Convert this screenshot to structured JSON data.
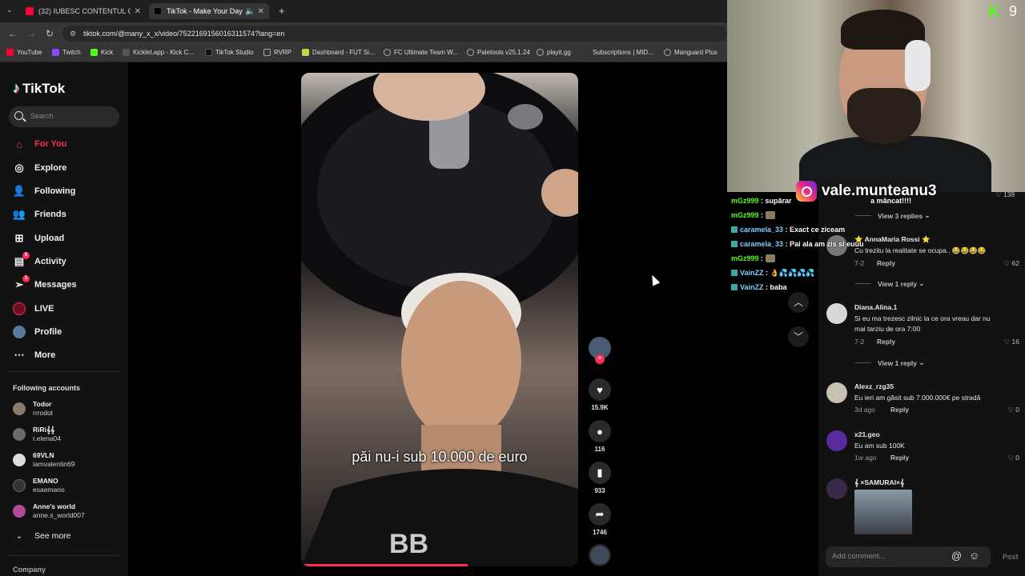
{
  "browser": {
    "tabs": [
      {
        "label": "(32) IUBESC CONTENTUL CRING",
        "active": false
      },
      {
        "label": "TikTok - Make Your Day",
        "active": true
      }
    ],
    "new_tab": "+",
    "url": "tiktok.com/@many_x_x/video/7522169156016311574?lang=en",
    "bookmarks": [
      "YouTube",
      "Twitch",
      "Kick",
      "Kicklet.app - Kick C...",
      "TikTok Studio",
      "RVRP",
      "Dashboard - FUT Si...",
      "FC Ultimate Team W...",
      "Paletools v25.1.24",
      "playit.gg",
      "Subscriptions | MID...",
      "Manguard Plus"
    ]
  },
  "sidebar": {
    "logo": "TikTok",
    "search_placeholder": "Search",
    "nav": [
      {
        "label": "For You",
        "icon": "home-icon",
        "active": true
      },
      {
        "label": "Explore",
        "icon": "compass-icon"
      },
      {
        "label": "Following",
        "icon": "following-icon"
      },
      {
        "label": "Friends",
        "icon": "friends-icon"
      },
      {
        "label": "Upload",
        "icon": "upload-icon"
      },
      {
        "label": "Activity",
        "icon": "activity-icon",
        "badge": "5"
      },
      {
        "label": "Messages",
        "icon": "messages-icon",
        "badge": "1"
      },
      {
        "label": "LIVE",
        "icon": "live-icon"
      },
      {
        "label": "Profile",
        "icon": "profile-icon"
      },
      {
        "label": "More",
        "icon": "more-icon"
      }
    ],
    "following_title": "Following accounts",
    "accounts": [
      {
        "name": "Todor",
        "handle": "rrrodot"
      },
      {
        "name": "RiRi𝄞𝄞",
        "handle": "r.elena04"
      },
      {
        "name": "69VLN",
        "handle": "iamvalentin69"
      },
      {
        "name": "EMANO",
        "handle": "esaemano"
      },
      {
        "name": "Anne's world",
        "handle": "anne.s_world007"
      }
    ],
    "see_more": "See more",
    "company": "Company"
  },
  "video": {
    "caption": "păi nu-i sub 10.000 de euro",
    "progress": 0.6,
    "actions": {
      "likes": "15.9K",
      "comments": "116",
      "saves": "933",
      "shares": "1746"
    }
  },
  "stream": {
    "kick_count": "9",
    "instagram": "vale.munteanu3",
    "chat": [
      {
        "user": "mGz999",
        "msg": ": supărar",
        "tail": "a mâncat!!!!",
        "style": "green"
      },
      {
        "user": "mGz999",
        "msg": ":",
        "emote": true,
        "style": "green"
      },
      {
        "user": "caramela_33",
        "msg": ": Exact ce ziceam",
        "style": "blue",
        "badge": true
      },
      {
        "user": "caramela_33",
        "msg": ": Pai ala am zis si euuu",
        "style": "blue",
        "badge": true
      },
      {
        "user": "mGz999",
        "msg": ":",
        "emote": true,
        "style": "green"
      },
      {
        "user": "VainZZ",
        "msg": ": 👌💦💦💦💦",
        "style": "blue",
        "badge": true
      },
      {
        "user": "VainZZ",
        "msg": ": baba",
        "style": "blue",
        "badge": true
      }
    ]
  },
  "comments": {
    "top_like": "138",
    "items": [
      {
        "view_replies": "View 3 replies"
      },
      {
        "name": "⭐ AnnaMaria Rossi ⭐",
        "text": "Cu trezitu la realitate se ocupa.. 😂😂😂😂",
        "date": "7-2",
        "reply": "Reply",
        "likes": "62",
        "view_replies": "View 1 reply"
      },
      {
        "name": "Diana.Alina.1",
        "text": "Si eu ma trezesc zilnic la ce ora vreau dar nu mai tarziu de ora 7:00",
        "date": "7-2",
        "reply": "Reply",
        "likes": "16",
        "view_replies": "View 1 reply"
      },
      {
        "name": "Alexz_rzg35",
        "text": "Eu ieri am găsit sub 7.000.000€ pe stradă",
        "date": "3d ago",
        "reply": "Reply",
        "likes": "0"
      },
      {
        "name": "x21.geo",
        "text": "Eu am sub 100K",
        "date": "1w ago",
        "reply": "Reply",
        "likes": "0"
      },
      {
        "name": "𝄞 ×SAMURAI×𝄞",
        "text": ""
      }
    ],
    "add_placeholder": "Add comment...",
    "post": "Post"
  },
  "colors": {
    "accent": "#fe2c55",
    "kick_green": "#53fc18"
  }
}
